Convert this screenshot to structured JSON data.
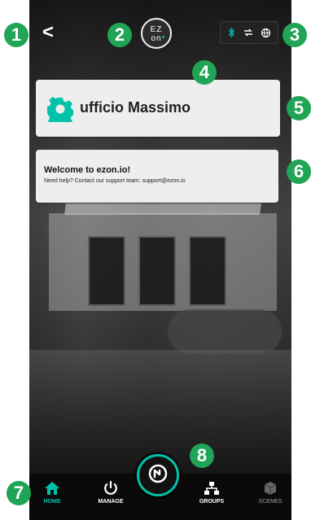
{
  "app": {
    "logo": {
      "top": "EZ",
      "bottom": "on"
    },
    "status_icons": [
      "bluetooth-icon",
      "sync-icon",
      "globe-icon"
    ],
    "colors": {
      "accent": "#00c2aa",
      "marker": "#20a455",
      "card": "#eeeeee",
      "nav_bg": "#111111"
    }
  },
  "header": {
    "back_label": "<"
  },
  "cards": {
    "workspace": {
      "name": "ufficio Massimo",
      "icon": "gear-icon"
    },
    "welcome": {
      "title": "Welcome to ezon.io!",
      "subtitle": "Need help? Contact our support team: support@ezon.io"
    }
  },
  "nav": [
    {
      "label": "HOME",
      "icon": "home-icon",
      "active": true
    },
    {
      "label": "MANAGE",
      "icon": "power-icon",
      "active": false
    },
    {
      "label": "GROUPS",
      "icon": "groups-icon",
      "active": false
    },
    {
      "label": "SCENES",
      "icon": "cube-icon",
      "active": false
    }
  ],
  "fab": {
    "icon": "clock-power-icon"
  },
  "markers": [
    "1",
    "2",
    "3",
    "4",
    "5",
    "6",
    "7",
    "8"
  ]
}
